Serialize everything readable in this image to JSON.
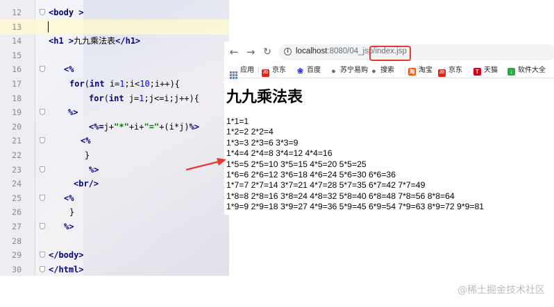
{
  "editor": {
    "lines": [
      {
        "n": "12",
        "segments": [
          {
            "t": "<body >",
            "c": "tag"
          }
        ]
      },
      {
        "n": "13",
        "segments": []
      },
      {
        "n": "14",
        "segments": [
          {
            "t": "<h1 >",
            "c": "tag"
          },
          {
            "t": "九九乘法表",
            "c": ""
          },
          {
            "t": "</h1>",
            "c": "tag"
          }
        ]
      },
      {
        "n": "15",
        "segments": []
      },
      {
        "n": "16",
        "segments": [
          {
            "t": "<%",
            "c": "tag"
          }
        ]
      },
      {
        "n": "17",
        "segments": [
          {
            "t": "for",
            "c": "kw"
          },
          {
            "t": "(",
            "c": ""
          },
          {
            "t": "int",
            "c": "kw"
          },
          {
            "t": " i=",
            "c": ""
          },
          {
            "t": "1",
            "c": "num"
          },
          {
            "t": ";i<",
            "c": ""
          },
          {
            "t": "10",
            "c": "num"
          },
          {
            "t": ";i++){",
            "c": ""
          }
        ]
      },
      {
        "n": "18",
        "segments": [
          {
            "t": "for",
            "c": "kw"
          },
          {
            "t": "(",
            "c": ""
          },
          {
            "t": "int",
            "c": "kw"
          },
          {
            "t": " j=",
            "c": ""
          },
          {
            "t": "1",
            "c": "num"
          },
          {
            "t": ";j<=i;j++){",
            "c": ""
          }
        ]
      },
      {
        "n": "19",
        "segments": [
          {
            "t": "%>",
            "c": "tag"
          }
        ]
      },
      {
        "n": "20",
        "segments": [
          {
            "t": "<%=",
            "c": "tag"
          },
          {
            "t": "j+",
            "c": ""
          },
          {
            "t": "\"*\"",
            "c": "str"
          },
          {
            "t": "+i+",
            "c": ""
          },
          {
            "t": "\"=\"",
            "c": "str"
          },
          {
            "t": "+(i*j)",
            "c": ""
          },
          {
            "t": "%>",
            "c": "tag"
          }
        ]
      },
      {
        "n": "21",
        "segments": [
          {
            "t": "<%",
            "c": "tag"
          }
        ]
      },
      {
        "n": "22",
        "segments": [
          {
            "t": "}",
            "c": ""
          }
        ]
      },
      {
        "n": "23",
        "segments": [
          {
            "t": "%>",
            "c": "tag"
          }
        ]
      },
      {
        "n": "24",
        "segments": [
          {
            "t": "<br/>",
            "c": "tag"
          }
        ]
      },
      {
        "n": "25",
        "segments": [
          {
            "t": "<%",
            "c": "tag"
          }
        ]
      },
      {
        "n": "26",
        "segments": [
          {
            "t": "}",
            "c": ""
          }
        ]
      },
      {
        "n": "27",
        "segments": [
          {
            "t": "%>",
            "c": "tag"
          }
        ]
      },
      {
        "n": "28",
        "segments": []
      },
      {
        "n": "29",
        "segments": [
          {
            "t": "</body>",
            "c": "tag"
          }
        ]
      },
      {
        "n": "30",
        "segments": [
          {
            "t": "</html>",
            "c": "tag"
          }
        ]
      }
    ]
  },
  "browser": {
    "url_host": "localhost",
    "url_rest": ":8080/04_jsp/index.jsp",
    "bookmarks": [
      {
        "label": "应用",
        "icon": "apps-grid-icon",
        "color": "#4285f4"
      },
      {
        "label": "京东",
        "icon": "jd-icon",
        "color": "#e1251b"
      },
      {
        "label": "百度",
        "icon": "baidu-paw-icon",
        "color": "#2932e1"
      },
      {
        "label": "苏宁易购",
        "icon": "globe-icon",
        "color": "#6b6b6b"
      },
      {
        "label": "搜索",
        "icon": "globe-icon",
        "color": "#6b6b6b"
      },
      {
        "label": "淘宝",
        "icon": "taobao-icon",
        "color": "#ff5000"
      },
      {
        "label": "京东",
        "icon": "jd-icon",
        "color": "#e1251b"
      },
      {
        "label": "天猫",
        "icon": "tmall-icon",
        "color": "#d0021b"
      },
      {
        "label": "软件大全",
        "icon": "download-icon",
        "color": "#2eaa42"
      }
    ],
    "page": {
      "heading": "九九乘法表",
      "rows": [
        "1*1=1",
        "1*2=2 2*2=4",
        "1*3=3 2*3=6 3*3=9",
        "1*4=4 2*4=8 3*4=12 4*4=16",
        "1*5=5 2*5=10 3*5=15 4*5=20 5*5=25",
        "1*6=6 2*6=12 3*6=18 4*6=24 5*6=30 6*6=36",
        "1*7=7 2*7=14 3*7=21 4*7=28 5*7=35 6*7=42 7*7=49",
        "1*8=8 2*8=16 3*8=24 4*8=32 5*8=40 6*8=48 7*8=56 8*8=64",
        "1*9=9 2*9=18 3*9=27 4*9=36 5*9=45 6*9=54 7*9=63 8*9=72 9*9=81"
      ]
    }
  },
  "annotation": {
    "arrow_color": "#e8392c",
    "box_color": "#e8392c"
  },
  "watermark": "@稀土掘金技术社区"
}
